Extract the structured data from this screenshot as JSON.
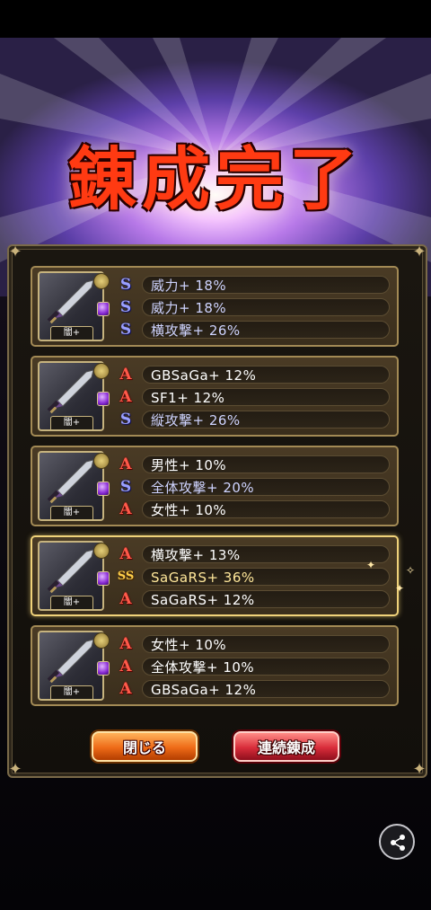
{
  "title": "錬成完了",
  "cards": [
    {
      "tag": "闇+",
      "effects": [
        {
          "rank": "S",
          "text": "威力+ 18%",
          "tone": "b"
        },
        {
          "rank": "S",
          "text": "威力+ 18%",
          "tone": "b"
        },
        {
          "rank": "S",
          "text": "横攻撃+ 26%",
          "tone": "b"
        }
      ]
    },
    {
      "tag": "闇+",
      "effects": [
        {
          "rank": "A",
          "text": "GBSaGa+ 12%",
          "tone": "w"
        },
        {
          "rank": "A",
          "text": "SF1+ 12%",
          "tone": "w"
        },
        {
          "rank": "S",
          "text": "縦攻撃+ 26%",
          "tone": "b"
        }
      ]
    },
    {
      "tag": "闇+",
      "effects": [
        {
          "rank": "A",
          "text": "男性+ 10%",
          "tone": "w"
        },
        {
          "rank": "S",
          "text": "全体攻撃+ 20%",
          "tone": "b"
        },
        {
          "rank": "A",
          "text": "女性+ 10%",
          "tone": "w"
        }
      ]
    },
    {
      "tag": "闇+",
      "effects": [
        {
          "rank": "A",
          "text": "横攻撃+ 13%",
          "tone": "w"
        },
        {
          "rank": "SS",
          "text": "SaGaRS+ 36%",
          "tone": "g"
        },
        {
          "rank": "A",
          "text": "SaGaRS+ 12%",
          "tone": "w"
        }
      ]
    },
    {
      "tag": "闇+",
      "effects": [
        {
          "rank": "A",
          "text": "女性+ 10%",
          "tone": "w"
        },
        {
          "rank": "A",
          "text": "全体攻撃+ 10%",
          "tone": "w"
        },
        {
          "rank": "A",
          "text": "GBSaGa+ 12%",
          "tone": "w"
        }
      ]
    }
  ],
  "rank_labels": {
    "A": "A",
    "S": "S",
    "SS": "SS"
  },
  "buttons": {
    "close": "閉じる",
    "continue": "連続錬成"
  },
  "icons": {
    "share": "share-icon",
    "weapon": "sword-icon"
  },
  "colors": {
    "title": "#ff3a12",
    "rank_a": "#ff5a4a",
    "rank_s": "#9aa0ff",
    "rank_ss": "#ffcf4a",
    "close_button": "#ee6a17",
    "continue_button": "#d82c3a"
  }
}
